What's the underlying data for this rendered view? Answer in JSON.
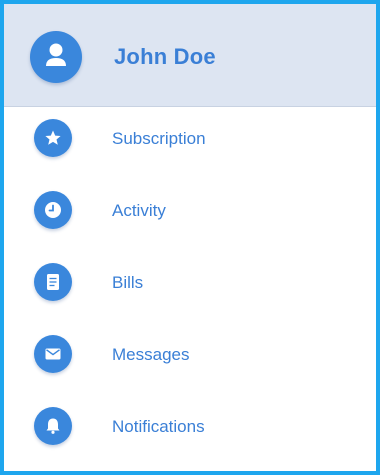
{
  "colors": {
    "frame_border": "#1ea6ee",
    "header_bg": "#dde5f2",
    "accent": "#3a87dc",
    "text": "#3a7fd6"
  },
  "header": {
    "avatar_icon": "user-icon",
    "name": "John Doe"
  },
  "menu": {
    "items": [
      {
        "label": "Subscription",
        "icon": "star-icon"
      },
      {
        "label": "Activity",
        "icon": "clock-icon"
      },
      {
        "label": "Bills",
        "icon": "document-icon"
      },
      {
        "label": "Messages",
        "icon": "envelope-icon"
      },
      {
        "label": "Notifications",
        "icon": "bell-icon"
      }
    ]
  }
}
